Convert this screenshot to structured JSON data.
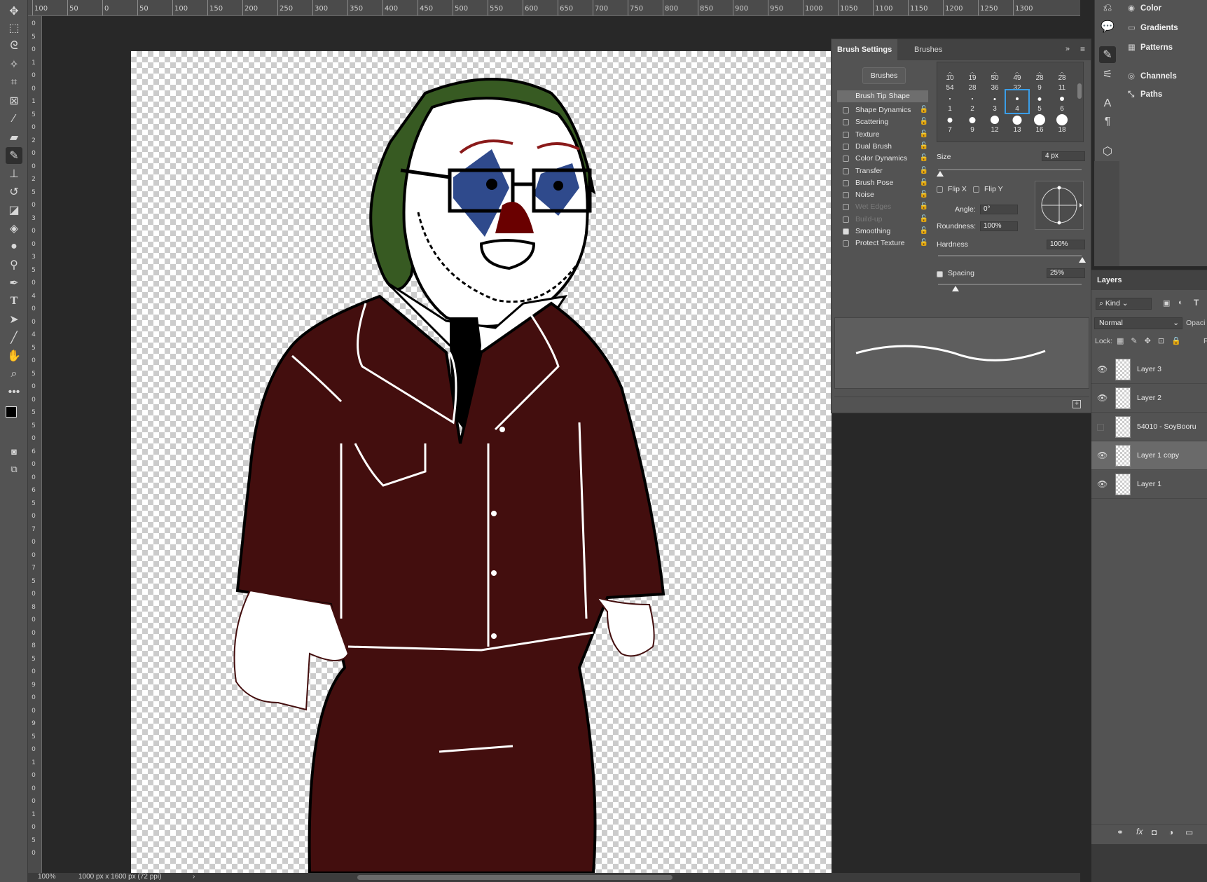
{
  "toolbar": {
    "tools": [
      "move-tool",
      "marquee-tool",
      "lasso-tool",
      "magic-wand-tool",
      "crop-tool",
      "frame-tool",
      "eyedropper-tool",
      "healing-brush-tool",
      "brush-tool",
      "clone-stamp-tool",
      "history-brush-tool",
      "eraser-tool",
      "paint-bucket-tool",
      "blur-tool",
      "dodge-tool",
      "pen-tool",
      "type-tool",
      "path-selection-tool",
      "line-tool",
      "hand-tool",
      "zoom-tool",
      "more-tools"
    ],
    "active_tool": "brush-tool",
    "foreground_color": "#000000",
    "background_color": "#ffffff"
  },
  "rulers": {
    "top_labels": [
      "100",
      "50",
      "0",
      "50",
      "100",
      "150",
      "200",
      "250",
      "300",
      "350",
      "400",
      "450",
      "500",
      "550",
      "600",
      "650",
      "700",
      "750",
      "800",
      "850",
      "900",
      "950",
      "1000",
      "1050",
      "1100",
      "1150",
      "1200",
      "1250",
      "1300"
    ],
    "left_labels": [
      "0",
      "5",
      "0",
      "1",
      "0",
      "0",
      "1",
      "5",
      "0",
      "2",
      "0",
      "0",
      "2",
      "5",
      "0",
      "3",
      "0",
      "0",
      "3",
      "5",
      "0",
      "4",
      "0",
      "0",
      "4",
      "5",
      "0",
      "5",
      "0",
      "0",
      "5",
      "5",
      "0",
      "6",
      "0",
      "0",
      "6",
      "5",
      "0",
      "7",
      "0",
      "0",
      "7",
      "5",
      "0",
      "8",
      "0",
      "0",
      "8",
      "5",
      "0",
      "9",
      "0",
      "0",
      "9",
      "5",
      "0",
      "1",
      "0",
      "0",
      "0",
      "1",
      "0",
      "5",
      "0"
    ]
  },
  "status": {
    "zoom": "100%",
    "doc_size": "1000 px x 1600 px (72 ppi)",
    "arrow": "›"
  },
  "brush_settings": {
    "tabs": [
      "Brush Settings",
      "Brushes"
    ],
    "brushes_button": "Brushes",
    "tip_shape_label": "Brush Tip Shape",
    "options": [
      {
        "label": "Shape Dynamics",
        "checked": false,
        "enabled": true
      },
      {
        "label": "Scattering",
        "checked": false,
        "enabled": true
      },
      {
        "label": "Texture",
        "checked": false,
        "enabled": true
      },
      {
        "label": "Dual Brush",
        "checked": false,
        "enabled": true
      },
      {
        "label": "Color Dynamics",
        "checked": false,
        "enabled": true
      },
      {
        "label": "Transfer",
        "checked": false,
        "enabled": true
      },
      {
        "label": "Brush Pose",
        "checked": false,
        "enabled": true
      },
      {
        "label": "Noise",
        "checked": false,
        "enabled": true
      },
      {
        "label": "Wet Edges",
        "checked": false,
        "enabled": false
      },
      {
        "label": "Build-up",
        "checked": false,
        "enabled": false
      },
      {
        "label": "Smoothing",
        "checked": true,
        "enabled": true
      },
      {
        "label": "Protect Texture",
        "checked": false,
        "enabled": true
      }
    ],
    "brush_grid_top_numbers": [
      "10",
      "19",
      "50",
      "49",
      "28",
      "28"
    ],
    "brush_grid_row1": [
      "54",
      "28",
      "36",
      "32",
      "9",
      "11"
    ],
    "brush_grid_row2": [
      "1",
      "2",
      "3",
      "4",
      "5",
      "6"
    ],
    "brush_grid_row3": [
      "7",
      "9",
      "12",
      "13",
      "16",
      "18"
    ],
    "selected_brush": "4",
    "size_label": "Size",
    "size_value": "4 px",
    "flip_x": "Flip X",
    "flip_y": "Flip Y",
    "angle_label": "Angle:",
    "angle_value": "0°",
    "roundness_label": "Roundness:",
    "roundness_value": "100%",
    "hardness_label": "Hardness",
    "hardness_value": "100%",
    "spacing_label": "Spacing",
    "spacing_value": "25%",
    "spacing_checked": true
  },
  "dock": {
    "items": [
      {
        "icon": "color-icon",
        "label": "Color"
      },
      {
        "icon": "gradients-icon",
        "label": "Gradients"
      },
      {
        "icon": "patterns-icon",
        "label": "Patterns"
      },
      {
        "icon": "channels-icon",
        "label": "Channels"
      },
      {
        "icon": "paths-icon",
        "label": "Paths"
      }
    ]
  },
  "layers": {
    "title": "Layers",
    "filter_kind": "Kind",
    "blend_mode": "Normal",
    "opacity_label": "Opaci",
    "lock_label": "Lock:",
    "fill_label": "F",
    "items": [
      {
        "name": "Layer 3",
        "visible": true,
        "selected": false
      },
      {
        "name": "Layer 2",
        "visible": true,
        "selected": false
      },
      {
        "name": "54010 - SoyBooru",
        "visible": false,
        "selected": false
      },
      {
        "name": "Layer 1 copy",
        "visible": true,
        "selected": true
      },
      {
        "name": "Layer 1",
        "visible": true,
        "selected": false
      }
    ]
  },
  "colors": {
    "suit": "#430e0e",
    "hair": "#375a22",
    "eye_paint": "#2f4a8c",
    "nose": "#6a0000"
  }
}
